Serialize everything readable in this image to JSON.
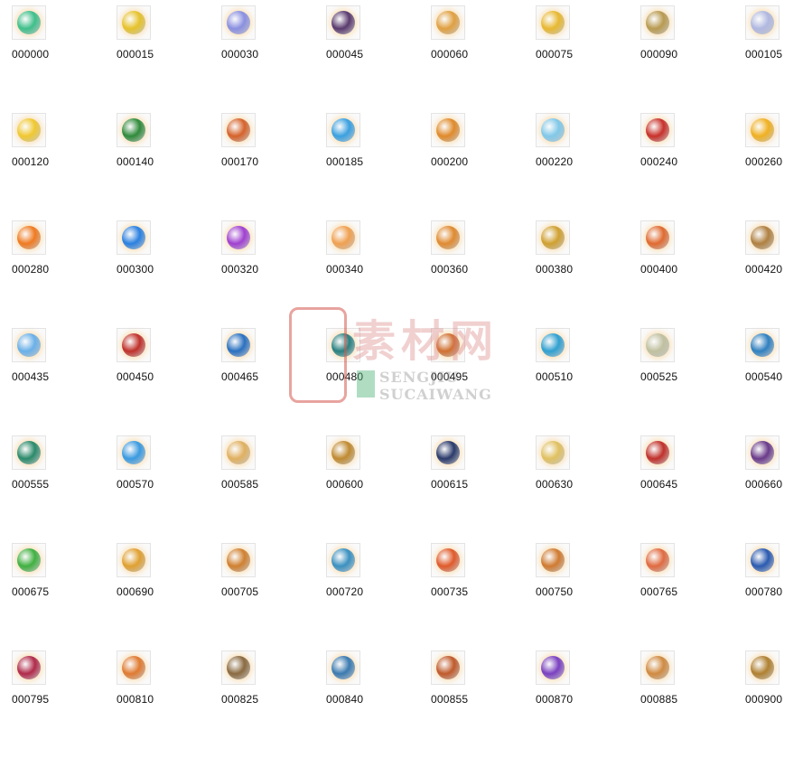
{
  "files": [
    {
      "name": "000000",
      "color": "#3fbf8a"
    },
    {
      "name": "000015",
      "color": "#e6c22a"
    },
    {
      "name": "000030",
      "color": "#8a8fe0"
    },
    {
      "name": "000045",
      "color": "#5a3a6e"
    },
    {
      "name": "000060",
      "color": "#e0a040"
    },
    {
      "name": "000075",
      "color": "#e8b830"
    },
    {
      "name": "000090",
      "color": "#b89a50"
    },
    {
      "name": "000105",
      "color": "#b0b8e0"
    },
    {
      "name": "000120",
      "color": "#f0c830"
    },
    {
      "name": "000140",
      "color": "#2f8a3a"
    },
    {
      "name": "000170",
      "color": "#d6622a"
    },
    {
      "name": "000185",
      "color": "#3aa0e0"
    },
    {
      "name": "000200",
      "color": "#e08a2a"
    },
    {
      "name": "000220",
      "color": "#80c8e8"
    },
    {
      "name": "000240",
      "color": "#c8302a"
    },
    {
      "name": "000260",
      "color": "#f0b020"
    },
    {
      "name": "000280",
      "color": "#f07a20"
    },
    {
      "name": "000300",
      "color": "#2a80e0"
    },
    {
      "name": "000320",
      "color": "#a040d0"
    },
    {
      "name": "000340",
      "color": "#f0a050"
    },
    {
      "name": "000360",
      "color": "#e08a30"
    },
    {
      "name": "000380",
      "color": "#d0a030"
    },
    {
      "name": "000400",
      "color": "#e06a30"
    },
    {
      "name": "000420",
      "color": "#b08040"
    },
    {
      "name": "000435",
      "color": "#6ab0e8"
    },
    {
      "name": "000450",
      "color": "#c0302a"
    },
    {
      "name": "000465",
      "color": "#2a70c0"
    },
    {
      "name": "000480",
      "color": "#2a8080"
    },
    {
      "name": "000495",
      "color": "#d07030"
    },
    {
      "name": "000510",
      "color": "#30a0d0"
    },
    {
      "name": "000525",
      "color": "#c0c0a0"
    },
    {
      "name": "000540",
      "color": "#3080c0"
    },
    {
      "name": "000555",
      "color": "#2a8a6a"
    },
    {
      "name": "000570",
      "color": "#3a9ae0"
    },
    {
      "name": "000585",
      "color": "#e0b060"
    },
    {
      "name": "000600",
      "color": "#c08a30"
    },
    {
      "name": "000615",
      "color": "#2a3a6a"
    },
    {
      "name": "000630",
      "color": "#e0c060"
    },
    {
      "name": "000645",
      "color": "#c0302a"
    },
    {
      "name": "000660",
      "color": "#6a3a8a"
    },
    {
      "name": "000675",
      "color": "#40b040"
    },
    {
      "name": "000690",
      "color": "#e0a030"
    },
    {
      "name": "000705",
      "color": "#d08030"
    },
    {
      "name": "000720",
      "color": "#3a90c0"
    },
    {
      "name": "000735",
      "color": "#e05a2a"
    },
    {
      "name": "000750",
      "color": "#d07a30"
    },
    {
      "name": "000765",
      "color": "#e06a40"
    },
    {
      "name": "000780",
      "color": "#2a5ab0"
    },
    {
      "name": "000795",
      "color": "#b02a4a"
    },
    {
      "name": "000810",
      "color": "#e07a30"
    },
    {
      "name": "000825",
      "color": "#8a6a40"
    },
    {
      "name": "000840",
      "color": "#3a7ab0"
    },
    {
      "name": "000855",
      "color": "#c05a2a"
    },
    {
      "name": "000870",
      "color": "#7a40c0"
    },
    {
      "name": "000885",
      "color": "#d08a40"
    },
    {
      "name": "000900",
      "color": "#b08030"
    }
  ],
  "watermark": {
    "title": "素材网",
    "line1": "SENGJIU",
    "line2": "SUCAIWANG"
  }
}
